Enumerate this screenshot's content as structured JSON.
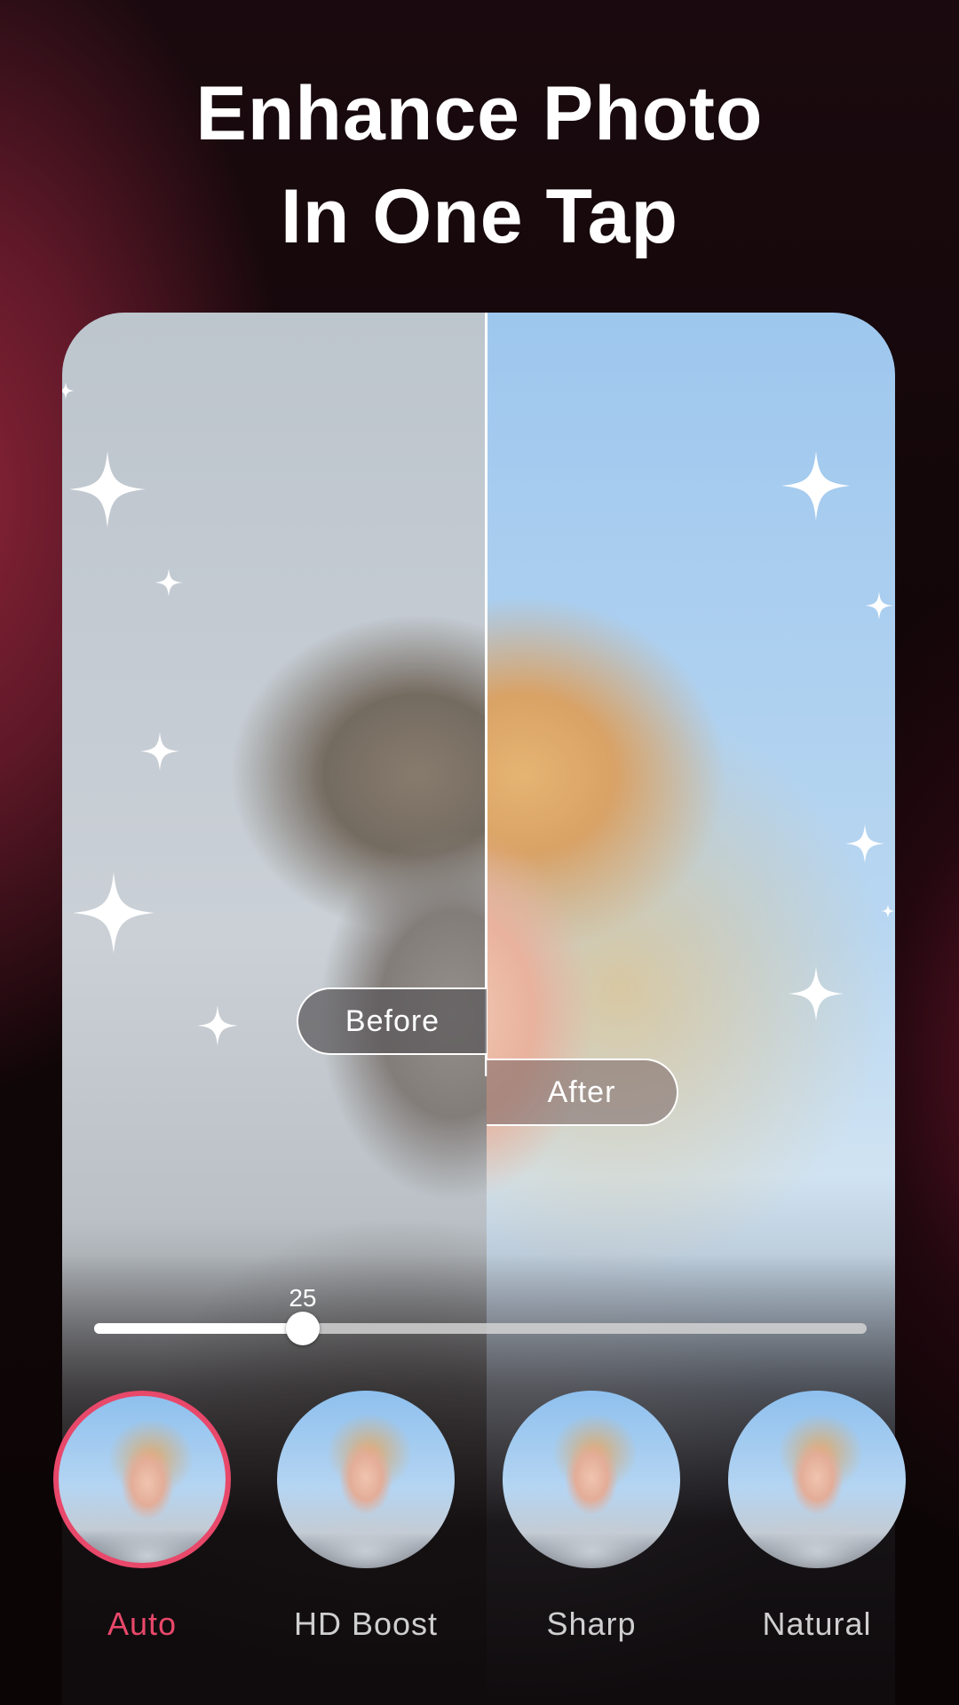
{
  "headline": {
    "line1": "Enhance Photo",
    "line2": "In One Tap"
  },
  "compare": {
    "before_label": "Before",
    "after_label": "After"
  },
  "slider": {
    "value_label": "25",
    "fraction": 0.27
  },
  "filters": [
    {
      "label": "Auto",
      "selected": true
    },
    {
      "label": "HD Boost",
      "selected": false
    },
    {
      "label": "Sharp",
      "selected": false
    },
    {
      "label": "Natural",
      "selected": false
    }
  ],
  "colors": {
    "accent": "#e8486a",
    "text": "#ffffff",
    "label_inactive": "#cfcfcf"
  },
  "icons": [
    "sparkle-icon"
  ]
}
